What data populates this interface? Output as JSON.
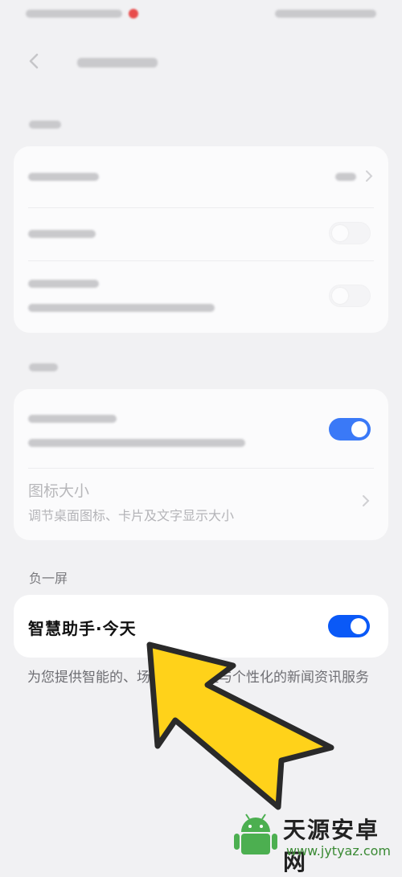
{
  "section_negative_screen": "负一屏",
  "icon_size": {
    "title": "图标大小",
    "subtitle": "调节桌面图标、卡片及文字显示大小"
  },
  "smart_assistant": {
    "title": "智慧助手·今天",
    "enabled": true
  },
  "description": "为您提供智能的、场景化的提醒与个性化的新闻资讯服务",
  "watermark": {
    "brand": "天源安卓网",
    "url": "www.jytyaz.com"
  },
  "colors": {
    "accent": "#0a59f7",
    "arrow_fill": "#ffd21a",
    "arrow_stroke": "#2a2a2a"
  },
  "icons": [
    "back-arrow-icon",
    "chevron-right-icon",
    "android-logo-icon"
  ]
}
